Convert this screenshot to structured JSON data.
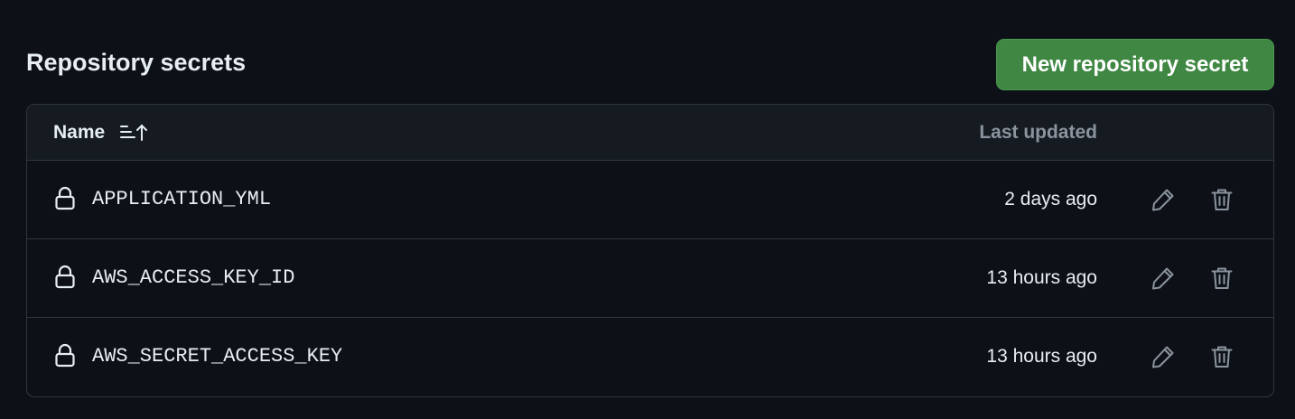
{
  "section": {
    "title": "Repository secrets",
    "new_button_label": "New repository secret"
  },
  "table": {
    "columns": {
      "name": "Name",
      "last_updated": "Last updated"
    },
    "rows": [
      {
        "name": "APPLICATION_YML",
        "updated": "2 days ago"
      },
      {
        "name": "AWS_ACCESS_KEY_ID",
        "updated": "13 hours ago"
      },
      {
        "name": "AWS_SECRET_ACCESS_KEY",
        "updated": "13 hours ago"
      }
    ]
  },
  "icons": {
    "sort": "sort-ascending-icon",
    "lock": "lock-icon",
    "edit": "pencil-icon",
    "delete": "trash-icon"
  },
  "colors": {
    "background": "#0d1117",
    "header_bg": "#161b22",
    "border": "#30363d",
    "primary_button": "#3f8743",
    "muted_text": "#8b949e",
    "text": "#e6edf3"
  }
}
